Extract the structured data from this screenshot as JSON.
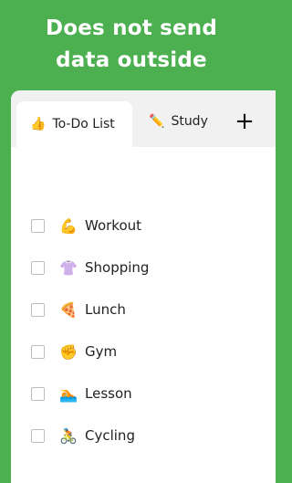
{
  "headline": {
    "line1": "Does not send",
    "line2": "data outside"
  },
  "tabs": [
    {
      "icon": "👍",
      "label": "To-Do List",
      "active": true
    },
    {
      "icon": "✏️",
      "label": "Study",
      "active": false
    }
  ],
  "add_tab_label": "+",
  "todos": [
    {
      "icon": "💪",
      "label": "Workout",
      "checked": false
    },
    {
      "icon": "👚",
      "label": "Shopping",
      "checked": false
    },
    {
      "icon": "🍕",
      "label": "Lunch",
      "checked": false
    },
    {
      "icon": "✊",
      "label": "Gym",
      "checked": false
    },
    {
      "icon": "🏊",
      "label": "Lesson",
      "checked": false
    },
    {
      "icon": "🚴",
      "label": "Cycling",
      "checked": false
    }
  ],
  "colors": {
    "background": "#4caf50",
    "card": "#ffffff",
    "tabbar": "#f1f1f1"
  }
}
